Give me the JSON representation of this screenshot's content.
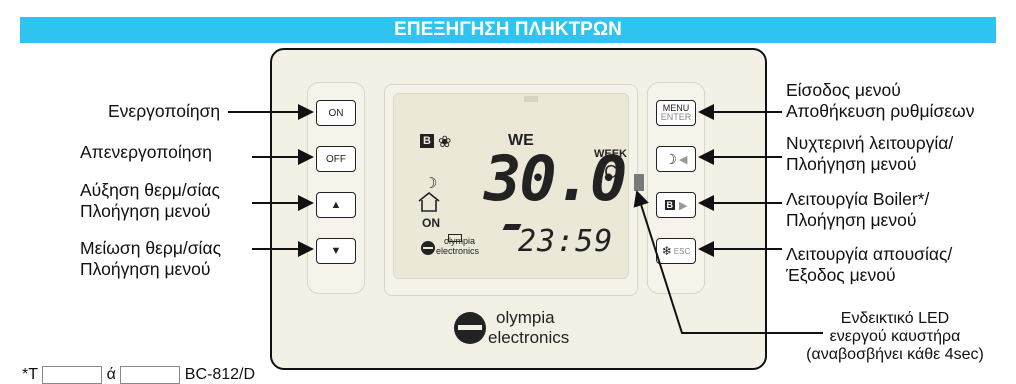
{
  "header": {
    "title": "ΕΠΕΞΗΓΗΣΗ ΠΛΗΚΤΡΩΝ"
  },
  "buttons": {
    "on": "ON",
    "off": "OFF",
    "menu_top": "MENU",
    "menu_bottom": "ENTER",
    "esc": "ESC"
  },
  "left_labels": {
    "on": "Ενεργοποίηση",
    "off": "Απενεργοποίηση",
    "up_line1": "Αύξηση θερμ/σίας",
    "up_line2": "Πλοήγηση μενού",
    "down_line1": "Μείωση θερμ/σίας",
    "down_line2": "Πλοήγηση μενού"
  },
  "right_labels": {
    "menu_line1": "Είσοδος μενού",
    "menu_line2": "Αποθήκευση ρυθμίσεων",
    "night_line1": "Νυχτερινή λειτουργία/",
    "night_line2": "Πλοήγηση μενού",
    "boiler_line1": "Λειτουργία Boiler*/",
    "boiler_line2": "Πλοήγηση μενού",
    "away_line1": "Λειτουργία απουσίας/",
    "away_line2": "Έξοδος μενού",
    "led_line1": "Ενδεικτικό LED",
    "led_line2": "ενεργού καυστήρα",
    "led_line3": "(αναβοσβήνει κάθε 4sec)"
  },
  "lcd": {
    "boiler_badge": "B",
    "day": "WE",
    "week": "WEEK",
    "status": "ON",
    "temperature": "30.0",
    "unit": "°C",
    "clock": "23:59",
    "logo_line1": "olympia",
    "logo_line2": "electronics"
  },
  "brand": {
    "line1": "olympia",
    "line2": "electronics"
  },
  "footnote": {
    "prefix": "*Τ",
    "mid": "ά",
    "suffix": "BC-812/D"
  },
  "colors": {
    "banner": "#2ec4ef",
    "device": "#f3f1e6"
  }
}
